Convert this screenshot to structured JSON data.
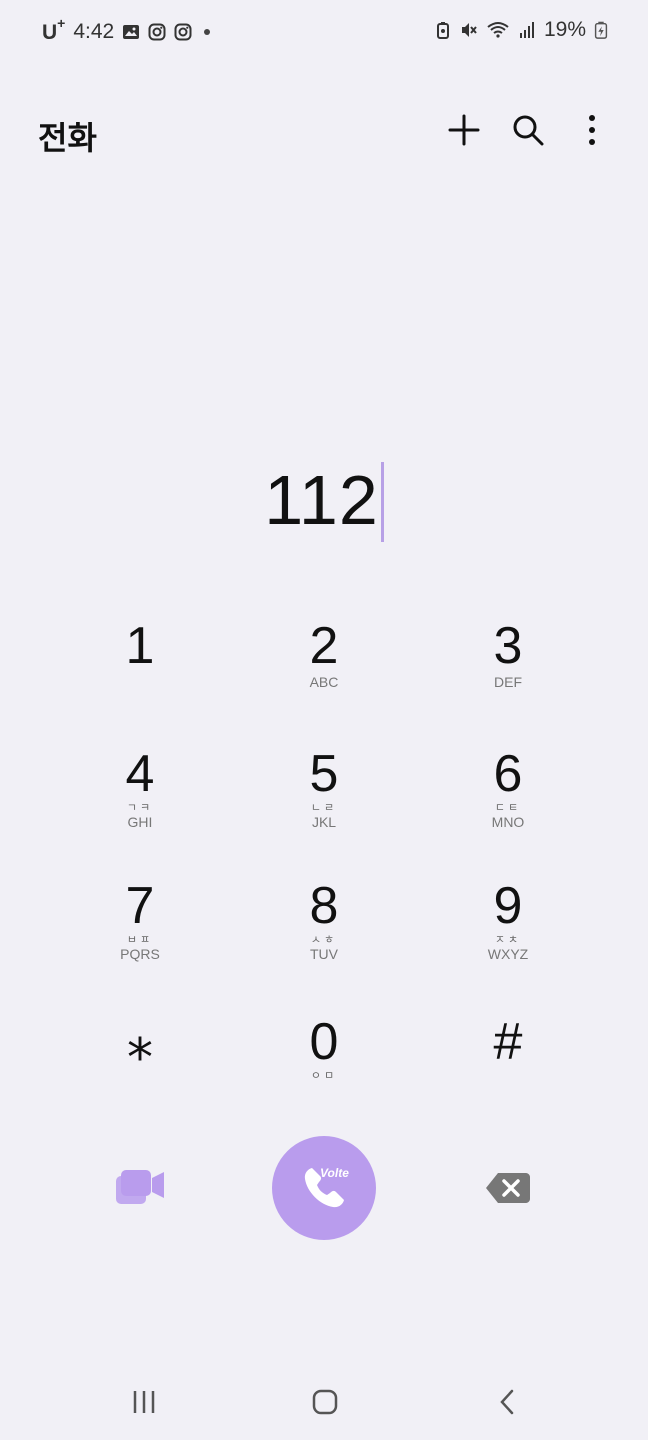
{
  "status": {
    "carrier": "U",
    "carrier_sup": "+",
    "time": "4:42",
    "battery": "19%"
  },
  "app_bar": {
    "title": "전화",
    "actions": [
      "add-icon",
      "search-icon",
      "more-options-icon"
    ]
  },
  "dialer": {
    "number": "112"
  },
  "keypad": {
    "keys": [
      {
        "digit": "1",
        "hangul": "",
        "letters": ""
      },
      {
        "digit": "2",
        "hangul": "",
        "letters": "ABC"
      },
      {
        "digit": "3",
        "hangul": "",
        "letters": "DEF"
      },
      {
        "digit": "4",
        "hangul": "ㄱㅋ",
        "letters": "GHI"
      },
      {
        "digit": "5",
        "hangul": "ㄴㄹ",
        "letters": "JKL"
      },
      {
        "digit": "6",
        "hangul": "ㄷㅌ",
        "letters": "MNO"
      },
      {
        "digit": "7",
        "hangul": "ㅂㅍ",
        "letters": "PQRS"
      },
      {
        "digit": "8",
        "hangul": "ㅅㅎ",
        "letters": "TUV"
      },
      {
        "digit": "9",
        "hangul": "ㅈㅊ",
        "letters": "WXYZ"
      },
      {
        "digit": "⁎",
        "hangul": "",
        "letters": ""
      },
      {
        "digit": "0",
        "hangul": "ㅇㅁ",
        "letters": ""
      },
      {
        "digit": "#",
        "hangul": "",
        "letters": ""
      }
    ]
  },
  "actions": {
    "call_badge": "Volte"
  },
  "colors": {
    "accent": "#b99ced",
    "background": "#f1f0f6"
  }
}
